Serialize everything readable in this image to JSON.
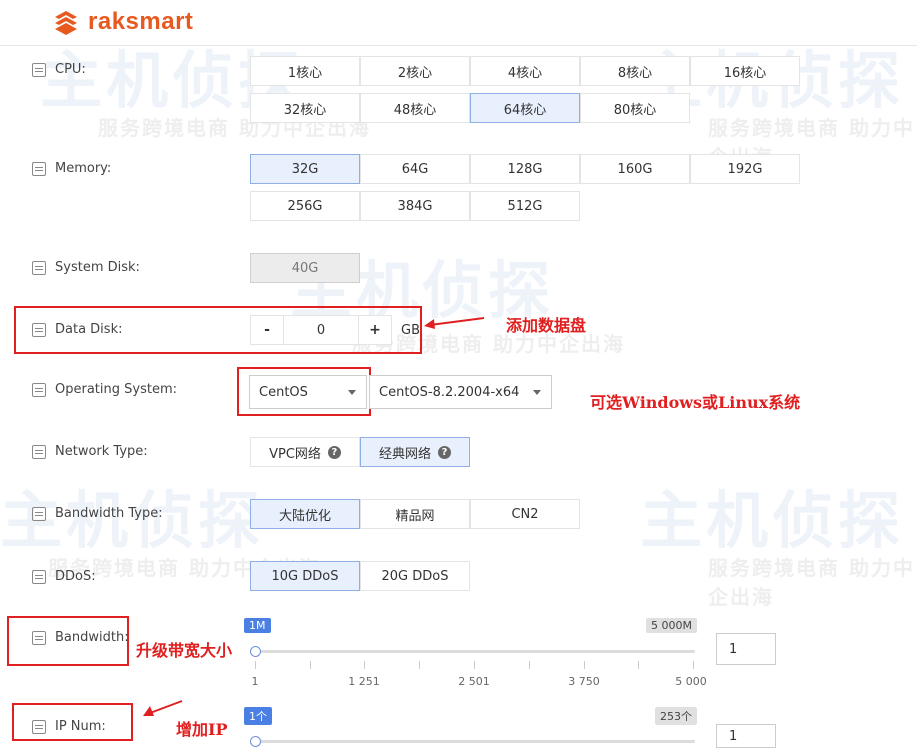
{
  "brand": {
    "name": "raksmart",
    "color": "#e8591f"
  },
  "watermark": {
    "big": "主机侦探",
    "small": "服务跨境电商 助力中企出海"
  },
  "cpu": {
    "label": "CPU:",
    "options": [
      "1核心",
      "2核心",
      "4核心",
      "8核心",
      "16核心",
      "32核心",
      "48核心",
      "64核心",
      "80核心"
    ],
    "selected": "64核心"
  },
  "memory": {
    "label": "Memory:",
    "options": [
      "32G",
      "64G",
      "128G",
      "160G",
      "192G",
      "256G",
      "384G",
      "512G"
    ],
    "selected": "32G"
  },
  "system_disk": {
    "label": "System Disk:",
    "value": "40G"
  },
  "data_disk": {
    "label": "Data Disk:",
    "minus": "-",
    "plus": "+",
    "value": "0",
    "unit": "GB",
    "annotation": "添加数据盘"
  },
  "os": {
    "label": "Operating System:",
    "family": "CentOS",
    "version": "CentOS-8.2.2004-x64",
    "annotation": "可选Windows或Linux系统"
  },
  "network_type": {
    "label": "Network Type:",
    "options": [
      "VPC网络",
      "经典网络"
    ],
    "selected": "经典网络",
    "help_icon": "question-circle-icon"
  },
  "bandwidth_type": {
    "label": "Bandwidth Type:",
    "options": [
      "大陆优化",
      "精品网",
      "CN2"
    ],
    "selected": "大陆优化"
  },
  "ddos": {
    "label": "DDoS:",
    "options": [
      "10G DDoS",
      "20G DDoS"
    ],
    "selected": "10G DDoS"
  },
  "bandwidth": {
    "label": "Bandwidth:",
    "min_badge": "1M",
    "max_badge": "5 000M",
    "ticks": [
      "1",
      "1 251",
      "2 501",
      "3 750",
      "5 000"
    ],
    "value": "1",
    "annotation": "升级带宽大小"
  },
  "ip_num": {
    "label": "IP Num:",
    "min_badge": "1个",
    "max_badge": "253个",
    "value": "1",
    "annotation": "增加IP"
  },
  "colors": {
    "accent": "#4a7fe3",
    "selected_bg": "#e8f0fd",
    "annotation": "#e02020"
  }
}
